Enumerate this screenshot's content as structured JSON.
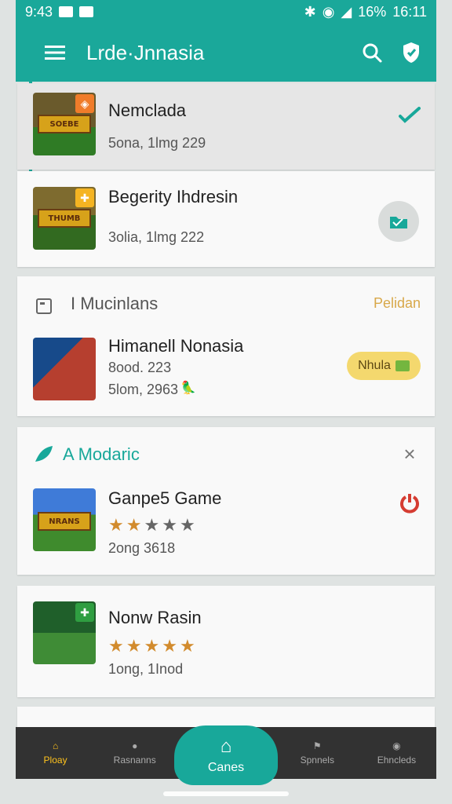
{
  "status": {
    "time_left": "9:43",
    "battery_text": "16%",
    "time_right": "16:11",
    "icons": [
      "notification-icon",
      "message-icon",
      "bluetooth-icon",
      "wifi-icon",
      "signal-icon",
      "battery-icon"
    ]
  },
  "appbar": {
    "title": "Lrde·Jnnasia",
    "menu_icon": "menu-icon",
    "search_icon": "search-icon",
    "profile_icon": "shield-icon"
  },
  "cards": [
    {
      "name": "Nemclada",
      "sub": "5ona, 1lmg 229",
      "thumb_title": "SOEBE",
      "thumb_badge_color": "#f07c2a",
      "action_icon": "check-icon"
    },
    {
      "name": "Begerity Ihdresin",
      "sub": "3olia, 1lmg 222",
      "thumb_title": "THUMB",
      "thumb_badge_color": "#f5b422",
      "action_icon": "folder-icon"
    },
    {
      "section_title": "I Mucinlans",
      "section_action": "Pelidan",
      "name": "Himanell Nonasia",
      "sub1": "8ood. 223",
      "sub2": "5lom, 2963",
      "pill": "Nhula",
      "action_icon": "tag-icon"
    },
    {
      "section_title": "A Modaric",
      "name": "Ganpe5 Game",
      "sub": "2ong 3618",
      "rating_text": "★★★★★",
      "rating_filled": 2,
      "thumb_title": "NRANS",
      "action_icon": "power-icon"
    },
    {
      "name": "Nonw Rasin",
      "sub": "1ong, 1Inod",
      "rating_text": "★★★★★",
      "rating_filled": 5,
      "thumb_title": "",
      "action_icon": ""
    }
  ],
  "nav": {
    "items": [
      {
        "label": "Ploay",
        "icon": "home-icon"
      },
      {
        "label": "Rasnanns",
        "icon": "person-icon"
      },
      {
        "label": "Canes",
        "icon": "home-icon"
      },
      {
        "label": "Spnnels",
        "icon": "flag-icon"
      },
      {
        "label": "Ehncleds",
        "icon": "user-icon"
      }
    ]
  },
  "colors": {
    "teal": "#1aa89a",
    "accent_orange": "#f18b3b",
    "card_bg": "#f9f9f9",
    "page_bg": "#dfe3e2"
  }
}
